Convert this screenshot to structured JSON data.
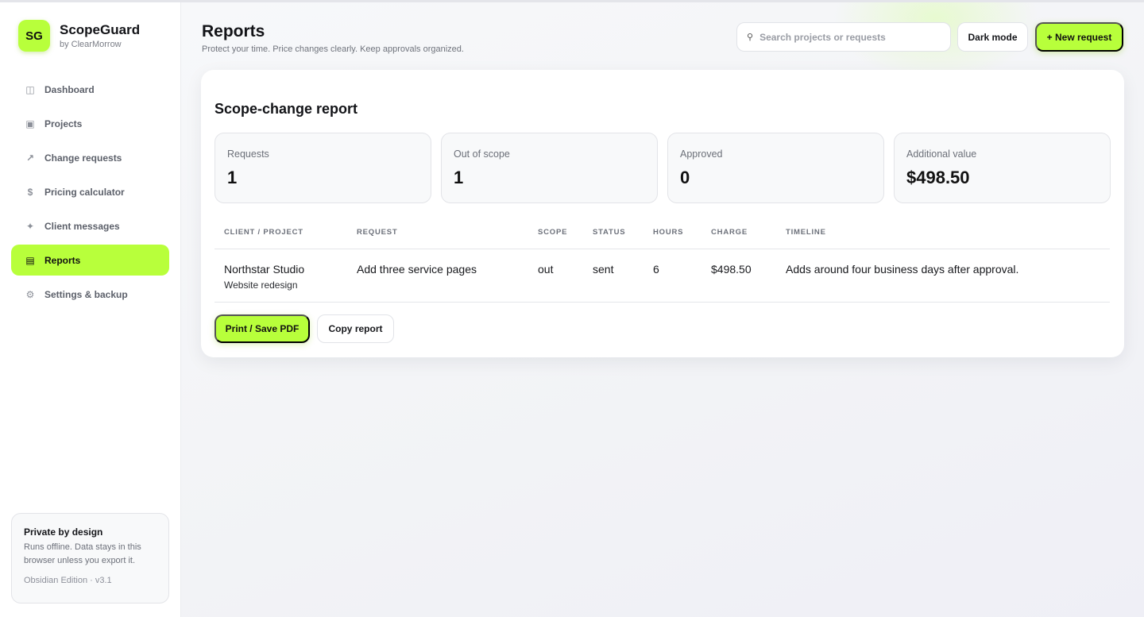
{
  "brand": {
    "logo": "SG",
    "name": "ScopeGuard",
    "sub": "by ClearMorrow"
  },
  "nav": [
    {
      "label": "Dashboard",
      "icon": "columns-icon",
      "glyph": "◫"
    },
    {
      "label": "Projects",
      "icon": "folder-icon",
      "glyph": "▣"
    },
    {
      "label": "Change requests",
      "icon": "arrow-up-right-icon",
      "glyph": "↗"
    },
    {
      "label": "Pricing calculator",
      "icon": "dollar-icon",
      "glyph": "$"
    },
    {
      "label": "Client messages",
      "icon": "sparkle-icon",
      "glyph": "✦"
    },
    {
      "label": "Reports",
      "icon": "list-icon",
      "glyph": "▤",
      "active": true
    },
    {
      "label": "Settings & backup",
      "icon": "gear-icon",
      "glyph": "⚙"
    }
  ],
  "privacy": {
    "title": "Private by design",
    "text": "Runs offline. Data stays in this browser unless you export it.",
    "version": "Obsidian Edition · v3.1"
  },
  "header": {
    "title": "Reports",
    "subtitle": "Protect your time. Price changes clearly. Keep approvals organized.",
    "search_placeholder": "Search projects or requests",
    "search_icon": "⚲",
    "dark_mode_label": "Dark mode",
    "new_request_label": "+ New request"
  },
  "report": {
    "title": "Scope-change report",
    "stats": [
      {
        "label": "Requests",
        "value": "1"
      },
      {
        "label": "Out of scope",
        "value": "1"
      },
      {
        "label": "Approved",
        "value": "0"
      },
      {
        "label": "Additional value",
        "value": "$498.50"
      }
    ],
    "columns": [
      "CLIENT / PROJECT",
      "REQUEST",
      "SCOPE",
      "STATUS",
      "HOURS",
      "CHARGE",
      "TIMELINE"
    ],
    "rows": [
      {
        "client": "Northstar Studio",
        "project": "Website redesign",
        "request": "Add three service pages",
        "scope": "out",
        "status": "sent",
        "hours": "6",
        "charge": "$498.50",
        "timeline": "Adds around four business days after approval."
      }
    ],
    "print_label": "Print / Save PDF",
    "copy_label": "Copy report"
  },
  "colors": {
    "accent": "#b8ff3b",
    "text": "#121317",
    "muted": "#6f737c"
  }
}
